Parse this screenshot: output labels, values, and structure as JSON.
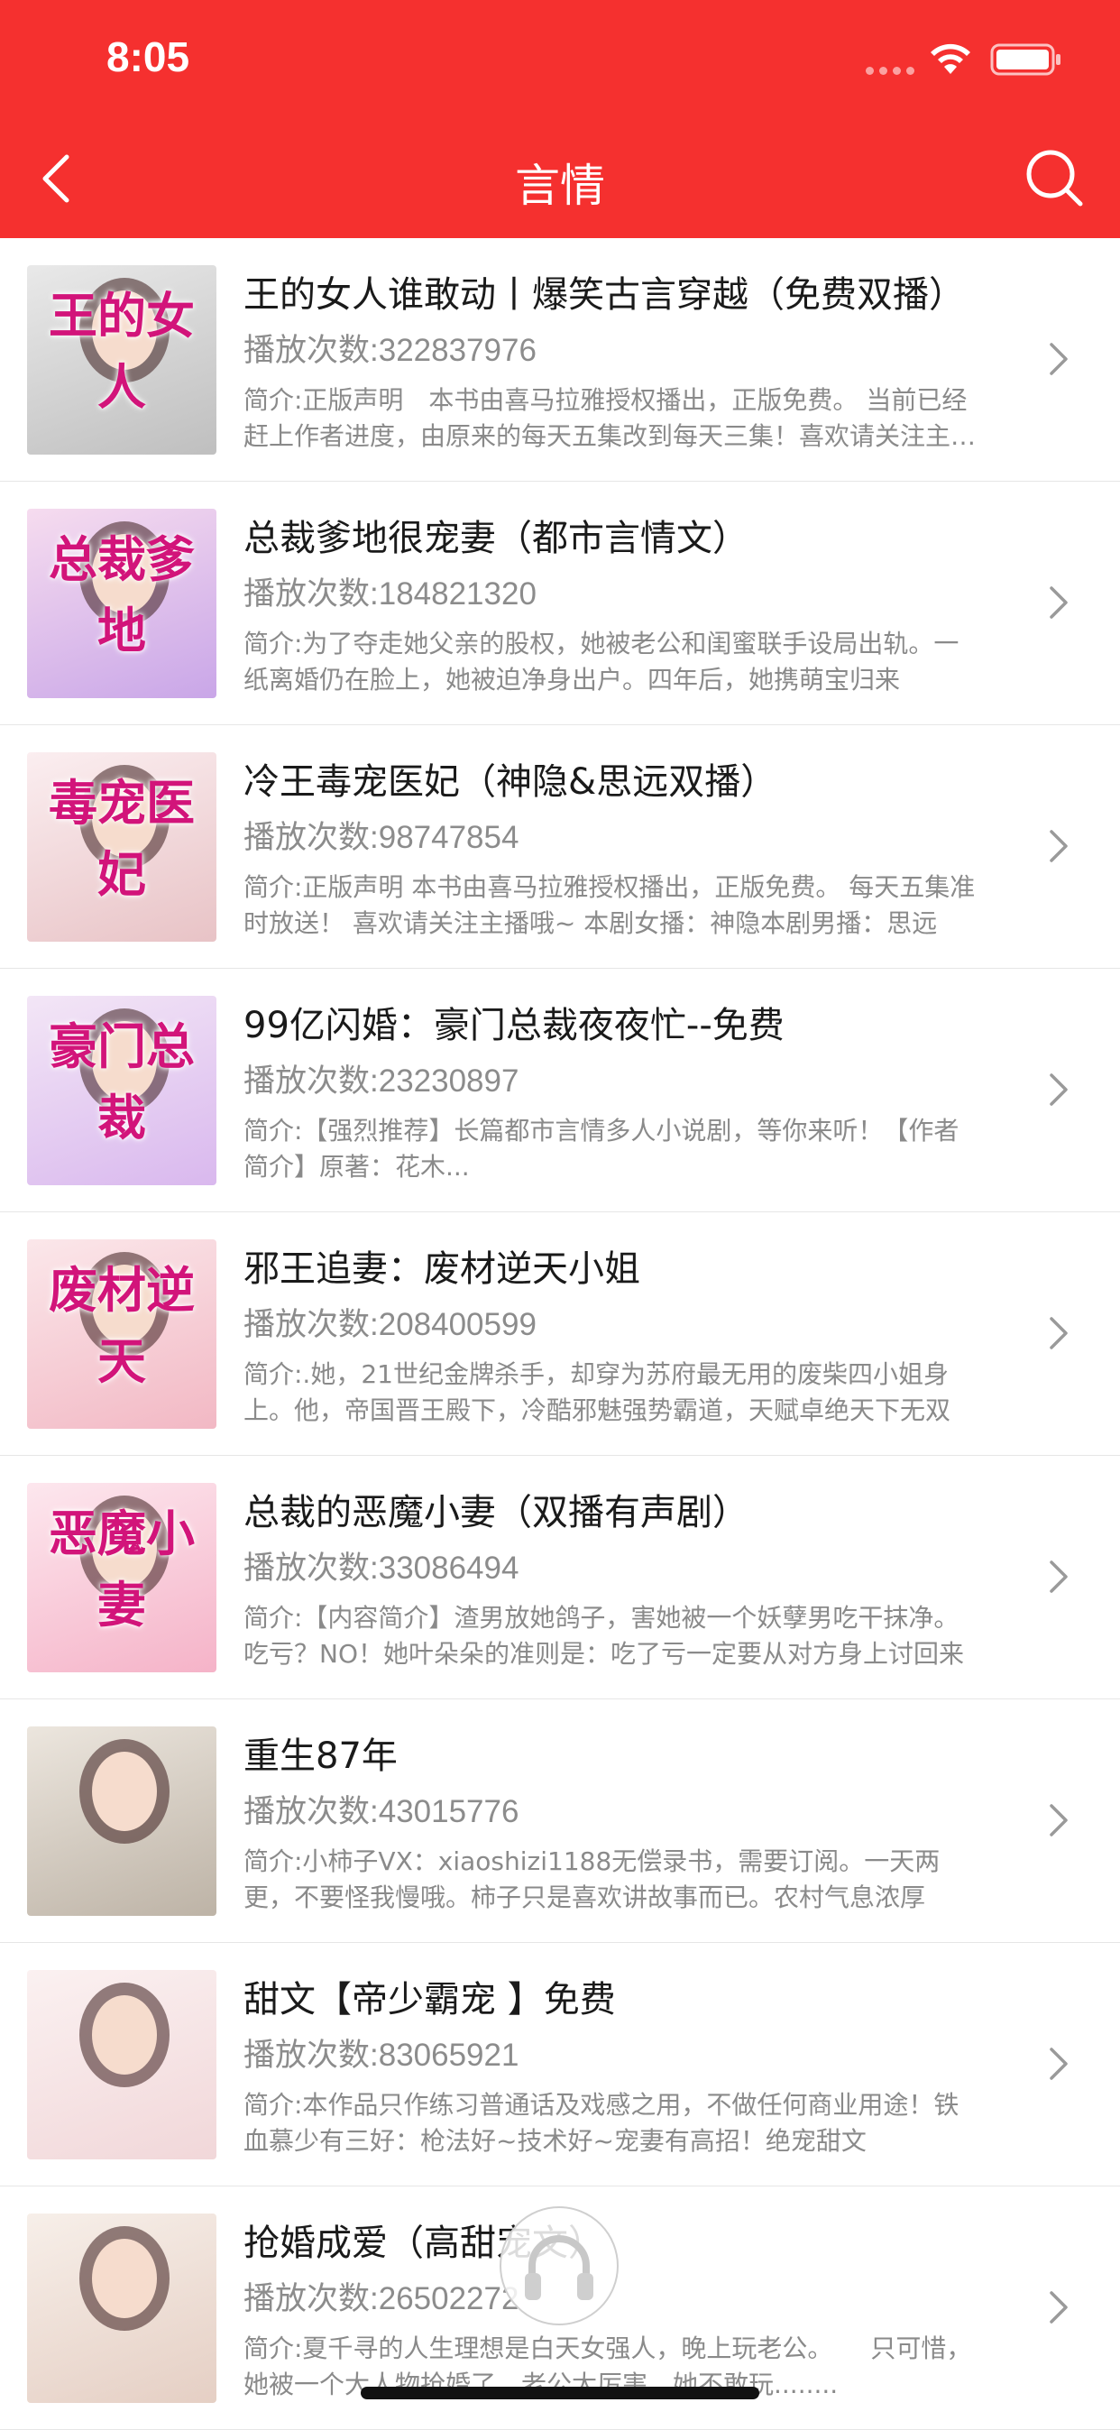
{
  "status": {
    "time": "8:05"
  },
  "nav": {
    "title": "言情",
    "back_icon": "chevron-left-icon",
    "search_icon": "search-icon"
  },
  "plays_prefix": "播放次数:",
  "items": [
    {
      "title": "王的女人谁敢动丨爆笑古言穿越（免费双播）",
      "plays": "322837976",
      "intro": "简介:正版声明　本书由喜马拉雅授权播出，正版免费。 当前已经赶上作者进度，由原来的每天五集改到每天三集！喜欢请关注主播哦~",
      "cover_text": "王的女人",
      "cover_colors": [
        "#e9e9e9",
        "#bfbfbf"
      ]
    },
    {
      "title": "总裁爹地很宠妻（都市言情文）",
      "plays": "184821320",
      "intro": "简介:为了夺走她父亲的股权，她被老公和闺蜜联手设局出轨。一纸离婚仍在脸上，她被迫净身出户。四年后，她携萌宝归来",
      "cover_text": "总裁爹地",
      "cover_colors": [
        "#f6dcef",
        "#c9a6e8"
      ]
    },
    {
      "title": "冷王毒宠医妃（神隐&思远双播）",
      "plays": "98747854",
      "intro": "简介:正版声明  本书由喜马拉雅授权播出，正版免费。 每天五集准时放送！ 喜欢请关注主播哦~ 本剧女播：神隐本剧男播：思远",
      "cover_text": "毒宠医妃",
      "cover_colors": [
        "#fbeef0",
        "#e8c3c6"
      ]
    },
    {
      "title": "99亿闪婚：豪门总裁夜夜忙--免费",
      "plays": "23230897",
      "intro": "简介:【强烈推荐】长篇都市言情多人小说剧，等你来听！【作者简介】原著：花木...",
      "cover_text": "豪门总裁",
      "cover_colors": [
        "#f3e6f6",
        "#d9b8ee"
      ]
    },
    {
      "title": "邪王追妻：废材逆天小姐",
      "plays": "208400599",
      "intro": "简介:.她，21世纪金牌杀手，却穿为苏府最无用的废柴四小姐身上。他，帝国晋王殿下，冷酷邪魅强势霸道，天赋卓绝天下无双",
      "cover_text": "废材逆天",
      "cover_colors": [
        "#fbe7ea",
        "#f2b8c4"
      ]
    },
    {
      "title": "总裁的恶魔小妻（双播有声剧）",
      "plays": "33086494",
      "intro": "简介:【内容简介】渣男放她鸽子，害她被一个妖孽男吃干抹净。吃亏？NO！她叶朵朵的准则是：吃了亏一定要从对方身上讨回来",
      "cover_text": "恶魔小妻",
      "cover_colors": [
        "#fde7ee",
        "#f5b3c8"
      ]
    },
    {
      "title": "重生87年",
      "plays": "43015776",
      "intro": "简介:小柿子VX：xiaoshizi1188无偿录书，需要订阅。一天两更，不要怪我慢哦。柿子只是喜欢讲故事而已。农村气息浓厚",
      "cover_text": "",
      "cover_colors": [
        "#ece6de",
        "#bdb3a6"
      ]
    },
    {
      "title": "甜文【帝少霸宠 】免费",
      "plays": "83065921",
      "intro": "简介:本作品只作练习普通话及戏感之用，不做任何商业用途！铁血慕少有三好：枪法好~技术好~宠妻有高招！绝宠甜文",
      "cover_text": "",
      "cover_colors": [
        "#fbf1f1",
        "#f1d7d9"
      ]
    },
    {
      "title": "抢婚成爱（高甜宠文）",
      "plays": "26502272",
      "intro": "简介:夏千寻的人生理想是白天女强人，晚上玩老公。　　只可惜，她被一个大人物抢婚了，老公太厉害，她不敢玩........",
      "cover_text": "",
      "cover_colors": [
        "#f7efe9",
        "#e5cfc4"
      ]
    }
  ]
}
